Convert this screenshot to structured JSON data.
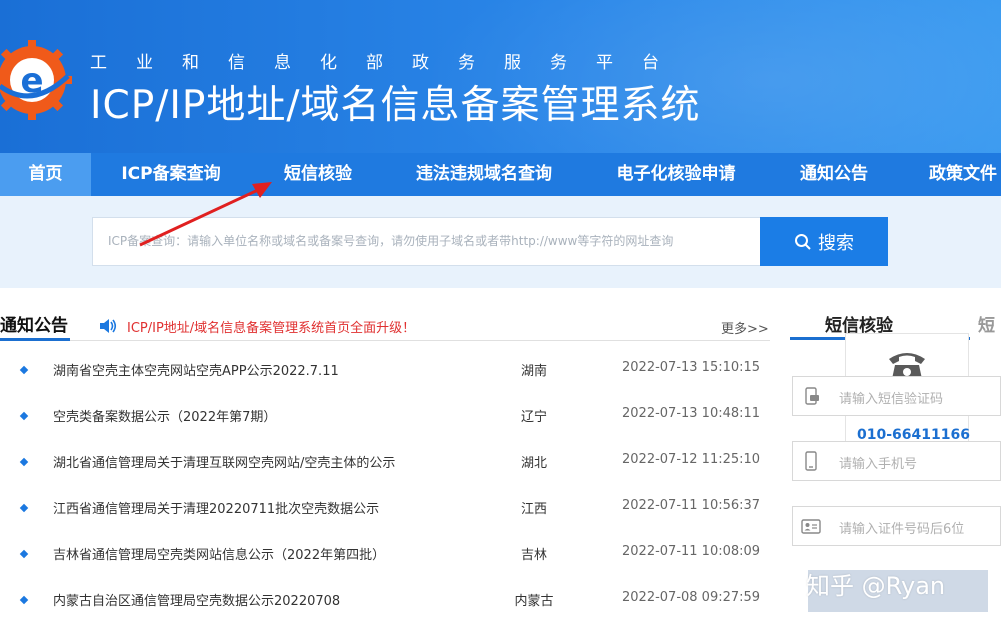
{
  "header": {
    "subtitle": "工业和信息化部政务服务平台",
    "title": "ICP/IP地址/域名信息备案管理系统"
  },
  "nav": {
    "items": [
      {
        "label": "首页"
      },
      {
        "label": "ICP备案查询"
      },
      {
        "label": "短信核验"
      },
      {
        "label": "违法违规域名查询"
      },
      {
        "label": "电子化核验申请"
      },
      {
        "label": "通知公告"
      },
      {
        "label": "政策文件"
      }
    ],
    "active_index": 0
  },
  "search": {
    "placeholder": "ICP备案查询：请输入单位名称或域名或备案号查询，请勿使用子域名或者带http://www等字符的网址查询",
    "button_label": "搜索"
  },
  "notice": {
    "heading": "通知公告",
    "marquee": "ICP/IP地址/域名信息备案管理系统首页全面升级！",
    "more_label": "更多>>",
    "rows": [
      {
        "title": "湖南省空壳主体空壳网站空壳APP公示2022.7.11",
        "province": "湖南",
        "date": "2022-07-13 15:10:15"
      },
      {
        "title": "空壳类备案数据公示（2022年第7期）",
        "province": "辽宁",
        "date": "2022-07-13 10:48:11"
      },
      {
        "title": "湖北省通信管理局关于清理互联网空壳网站/空壳主体的公示",
        "province": "湖北",
        "date": "2022-07-12 11:25:10"
      },
      {
        "title": "江西省通信管理局关于清理20220711批次空壳数据公示",
        "province": "江西",
        "date": "2022-07-11 10:56:37"
      },
      {
        "title": "吉林省通信管理局空壳类网站信息公示（2022年第四批）",
        "province": "吉林",
        "date": "2022-07-11 10:08:09"
      },
      {
        "title": "内蒙古自治区通信管理局空壳数据公示20220708",
        "province": "内蒙古",
        "date": "2022-07-08 09:27:59"
      }
    ]
  },
  "sms_panel": {
    "tab_label": "短信核验",
    "tab2_label": "短",
    "phone_number": "010-66411166",
    "fields": [
      {
        "placeholder": "请输入短信验证码",
        "icon": "sms-code-icon"
      },
      {
        "placeholder": "请输入手机号",
        "icon": "mobile-phone-icon"
      },
      {
        "placeholder": "请输入证件号码后6位",
        "icon": "id-card-icon"
      }
    ]
  },
  "watermark": "知乎 @Ryan",
  "colors": {
    "header_blue": "#1a6fd6",
    "nav_blue": "#1f7ae0",
    "nav_active": "#4b9df0",
    "search_button": "#1b7de6",
    "marquee_red": "#e03030",
    "arrow_red": "#e02020",
    "phone_number_blue": "#1b6fd0"
  }
}
